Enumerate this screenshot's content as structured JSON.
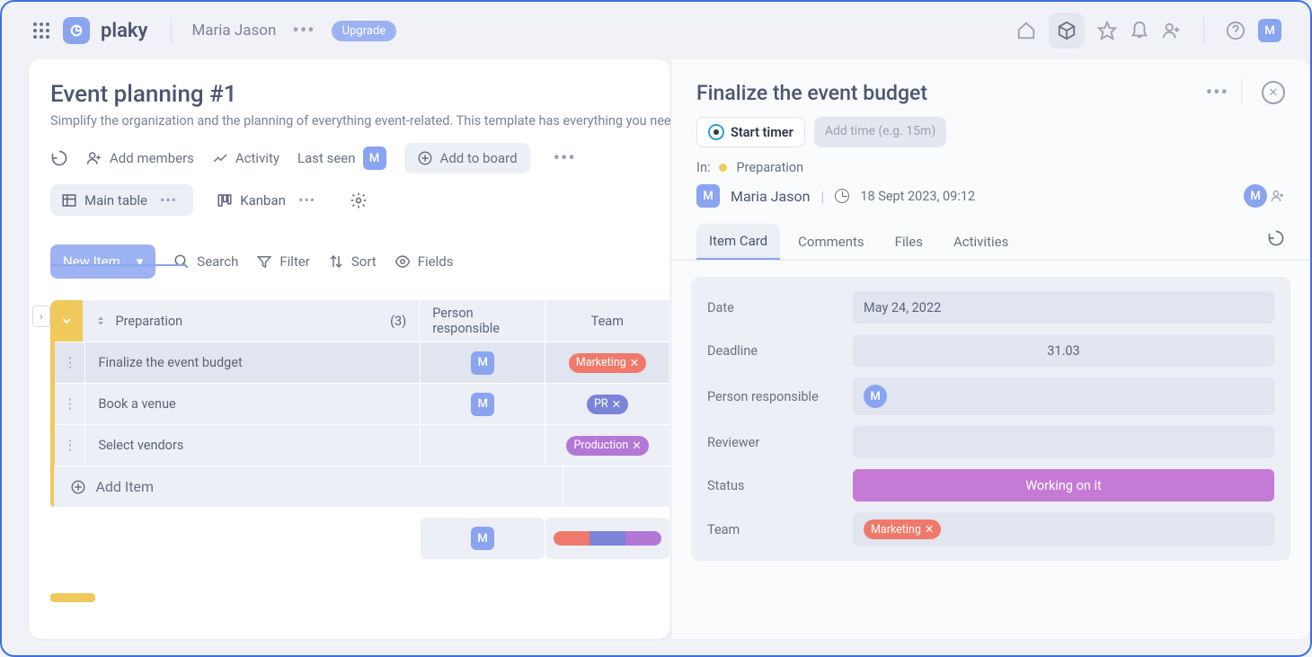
{
  "header": {
    "logo_text": "plaky",
    "user_name": "Maria Jason",
    "upgrade_label": "Upgrade",
    "avatar_letter": "M"
  },
  "board": {
    "title": "Event planning #1",
    "description": "Simplify the organization and the planning of everything event-related. This template has everything you need",
    "actions": {
      "add_members": "Add members",
      "activity": "Activity",
      "last_seen": "Last seen",
      "add_to_board": "Add to board"
    },
    "views": {
      "main_table": "Main table",
      "kanban": "Kanban"
    },
    "toolbar": {
      "new_item": "New Item",
      "search": "Search",
      "filter": "Filter",
      "sort": "Sort",
      "fields": "Fields"
    },
    "group": {
      "name": "Preparation",
      "count": "(3)",
      "col_person": "Person responsible",
      "col_team": "Team"
    },
    "rows": [
      {
        "name": "Finalize the event budget",
        "person": "M",
        "team": "Marketing",
        "team_tag": "marketing"
      },
      {
        "name": "Book a venue",
        "person": "M",
        "team": "PR",
        "team_tag": "pr"
      },
      {
        "name": "Select vendors",
        "person": "",
        "team": "Production",
        "team_tag": "production"
      }
    ],
    "add_item_label": "Add Item",
    "summary_person": "M"
  },
  "panel": {
    "title": "Finalize the event budget",
    "start_timer": "Start timer",
    "add_time_placeholder": "Add time (e.g. 15m)",
    "in_label": "In:",
    "in_group": "Preparation",
    "author": "Maria Jason",
    "created": "18 Sept 2023, 09:12",
    "avatar_letter": "M",
    "tabs": {
      "item_card": "Item Card",
      "comments": "Comments",
      "files": "Files",
      "activities": "Activities"
    },
    "fields": {
      "date_label": "Date",
      "date_value": "May 24, 2022",
      "deadline_label": "Deadline",
      "deadline_value": "31.03",
      "person_label": "Person responsible",
      "person_value": "M",
      "reviewer_label": "Reviewer",
      "reviewer_value": "",
      "status_label": "Status",
      "status_value": "Working on it",
      "team_label": "Team",
      "team_value": "Marketing"
    }
  }
}
